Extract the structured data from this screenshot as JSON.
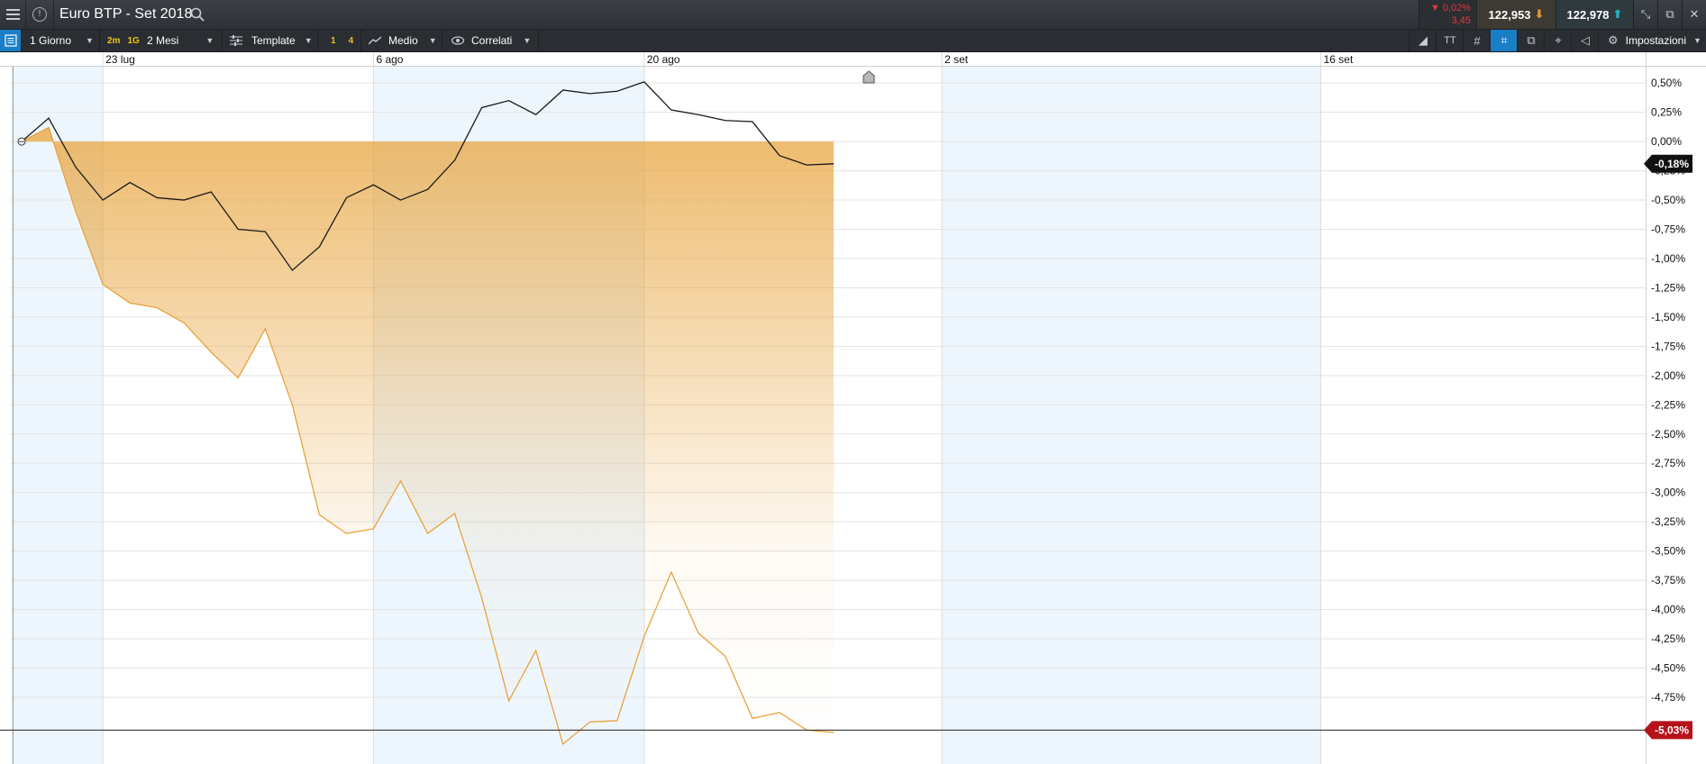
{
  "header": {
    "title": "Euro BTP - Set 2018",
    "change_pct": "▼ 0,02%",
    "change_abs": "3,45",
    "bid": "122,953",
    "ask": "122,978"
  },
  "toolbar": {
    "period": "1 Giorno",
    "chip_2m": "2m",
    "chip_1g": "1G",
    "range": "2 Mesi",
    "template": "Template",
    "chip_1": "1",
    "chip_4": "4",
    "indicator": "Medio",
    "correlated": "Correlati",
    "settings": "Impostazioni",
    "text_tool": "TT"
  },
  "colors": {
    "main_series": "#1a1a1a",
    "compare_series": "#e8a33a",
    "current_tag_bg": "#111111",
    "compare_tag_bg": "#b5121b",
    "weekend_band": "#eef6fd",
    "active_tool": "#1a7ec7"
  },
  "chart_data": {
    "type": "line",
    "x_labels": [
      "23 lug",
      "6 ago",
      "20 ago",
      "2 set",
      "16 set"
    ],
    "y_ticks": [
      "0,50%",
      "0,25%",
      "0,00%",
      "-0,25%",
      "-0,50%",
      "-0,75%",
      "-1,00%",
      "-1,25%",
      "-1,50%",
      "-1,75%",
      "-2,00%",
      "-2,25%",
      "-2,50%",
      "-2,75%",
      "-3,00%",
      "-3,25%",
      "-3,50%",
      "-3,75%",
      "-4,00%",
      "-4,25%",
      "-4,50%",
      "-4,75%"
    ],
    "y_tick_values": [
      0.5,
      0.25,
      0,
      -0.25,
      -0.5,
      -0.75,
      -1.0,
      -1.25,
      -1.5,
      -1.75,
      -2.0,
      -2.25,
      -2.5,
      -2.75,
      -3.0,
      -3.25,
      -3.5,
      -3.75,
      -4.0,
      -4.25,
      -4.5,
      -4.75
    ],
    "ylim": [
      -5.32,
      0.64
    ],
    "x_index_range": [
      -0.4,
      60
    ],
    "label_index": [
      3,
      13,
      23,
      34,
      48
    ],
    "series": [
      {
        "values": [
          0.0,
          0.2,
          -0.22,
          -0.5,
          -0.35,
          -0.48,
          -0.5,
          -0.43,
          -0.75,
          -0.77,
          -1.1,
          -0.9,
          -0.48,
          -0.37,
          -0.5,
          -0.41,
          -0.16,
          0.29,
          0.35,
          0.23,
          0.44,
          0.41,
          0.43,
          0.51,
          0.27,
          0.23,
          0.18,
          0.17,
          -0.12,
          -0.2,
          -0.19
        ],
        "last_label": "-0,18%"
      },
      {
        "values": [
          0.0,
          0.12,
          -0.6,
          -1.22,
          -1.38,
          -1.42,
          -1.55,
          -1.8,
          -2.02,
          -1.6,
          -2.25,
          -3.19,
          -3.35,
          -3.31,
          -2.9,
          -3.35,
          -3.18,
          -3.9,
          -4.78,
          -4.35,
          -5.15,
          -4.96,
          -4.95,
          -4.23,
          -3.68,
          -4.2,
          -4.4,
          -4.93,
          -4.88,
          -5.03,
          -5.05
        ],
        "last_label": "-5,03%"
      }
    ]
  }
}
